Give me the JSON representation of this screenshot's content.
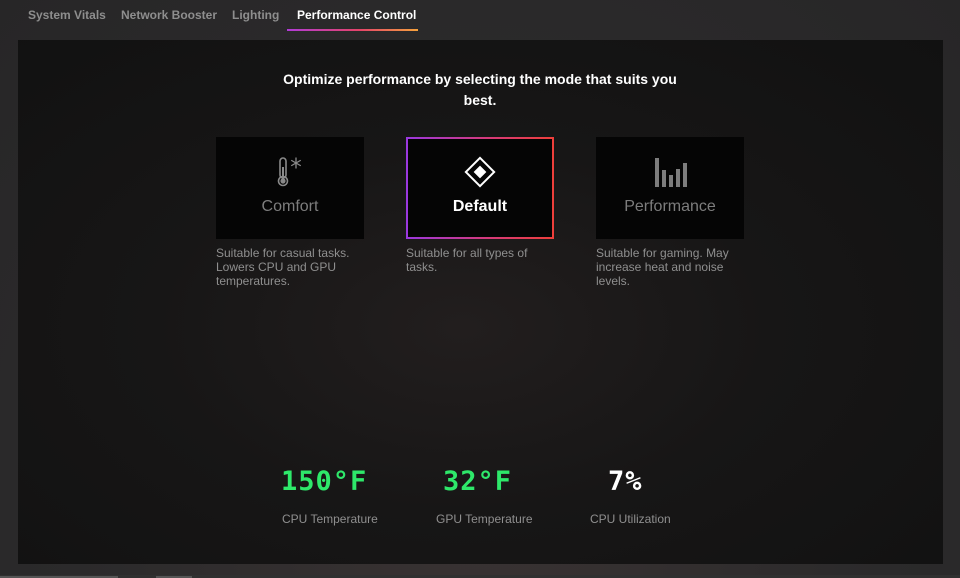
{
  "tabs": [
    {
      "label": "System Vitals"
    },
    {
      "label": "Network Booster"
    },
    {
      "label": "Lighting"
    },
    {
      "label": "Performance Control",
      "active": true
    }
  ],
  "heading": "Optimize performance by selecting the mode that suits you best.",
  "modes": [
    {
      "label": "Comfort",
      "icon": "thermometer-snowflake-icon",
      "description": "Suitable for casual tasks. Lowers CPU and GPU temperatures.",
      "selected": false
    },
    {
      "label": "Default",
      "icon": "diamond-icon",
      "description": "Suitable for all types of tasks.",
      "selected": true
    },
    {
      "label": "Performance",
      "icon": "bar-chart-icon",
      "description": "Suitable for gaming. May increase heat and noise levels.",
      "selected": false
    }
  ],
  "stats": [
    {
      "value": "150°F",
      "label": "CPU Temperature",
      "color": "#2ee86a"
    },
    {
      "value": "32°F",
      "label": "GPU Temperature",
      "color": "#2ee86a"
    },
    {
      "value": "7%",
      "label": "CPU Utilization",
      "color": "#ffffff"
    }
  ],
  "colors": {
    "accent_gradient_start": "#9a38e0",
    "accent_gradient_end": "#ee3f3a",
    "stat_green": "#2ee86a"
  }
}
